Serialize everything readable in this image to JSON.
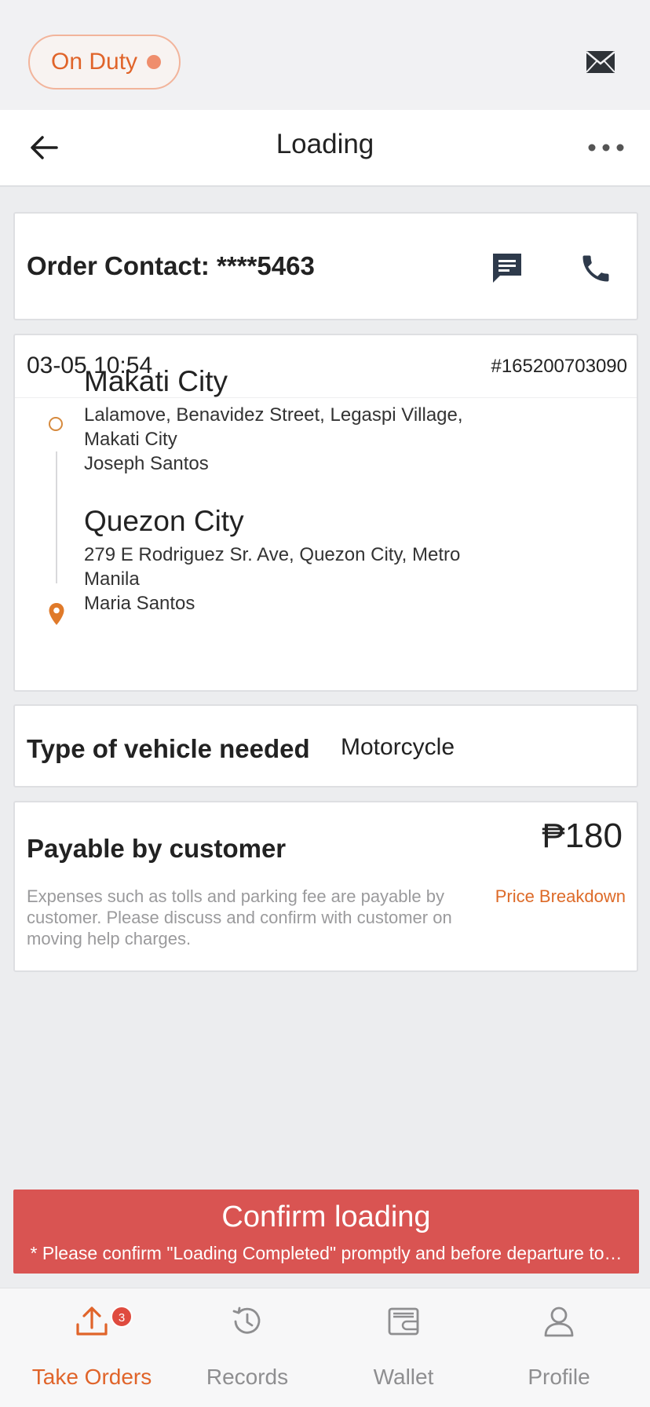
{
  "status": {
    "duty_label": "On Duty"
  },
  "nav": {
    "title": "Loading"
  },
  "contact": {
    "text": "Order Contact: ****5463"
  },
  "order": {
    "time": "03-05 10:54",
    "id": "#165200703090",
    "pickup": {
      "city": "Makati City",
      "address_line1": "Lalamove, Benavidez Street, Legaspi Village,",
      "address_line2": "Makati City",
      "contact": "Joseph Santos"
    },
    "dropoff": {
      "city": "Quezon City",
      "address_line1": "279 E Rodriguez Sr. Ave, Quezon City, Metro",
      "address_line2": "Manila",
      "contact": "Maria Santos"
    }
  },
  "vehicle": {
    "label": "Type of vehicle needed",
    "value": "Motorcycle"
  },
  "payment": {
    "label": "Payable by customer",
    "amount": "₱180",
    "note": "Expenses such as tolls and parking fee are payable by customer. Please discuss and confirm with customer on moving help charges.",
    "link": "Price Breakdown"
  },
  "confirm": {
    "title": "Confirm loading",
    "subtitle": "* Please confirm \"Loading Completed\" promptly and before departure to…"
  },
  "tabs": [
    {
      "label": "Take Orders",
      "icon": "upload-icon",
      "badge": "3",
      "active": true
    },
    {
      "label": "Records",
      "icon": "history-icon",
      "active": false
    },
    {
      "label": "Wallet",
      "icon": "wallet-icon",
      "active": false
    },
    {
      "label": "Profile",
      "icon": "person-icon",
      "active": false
    }
  ],
  "colors": {
    "accent": "#e0642a",
    "confirm_button": "#d95452",
    "background": "#ecedef"
  }
}
